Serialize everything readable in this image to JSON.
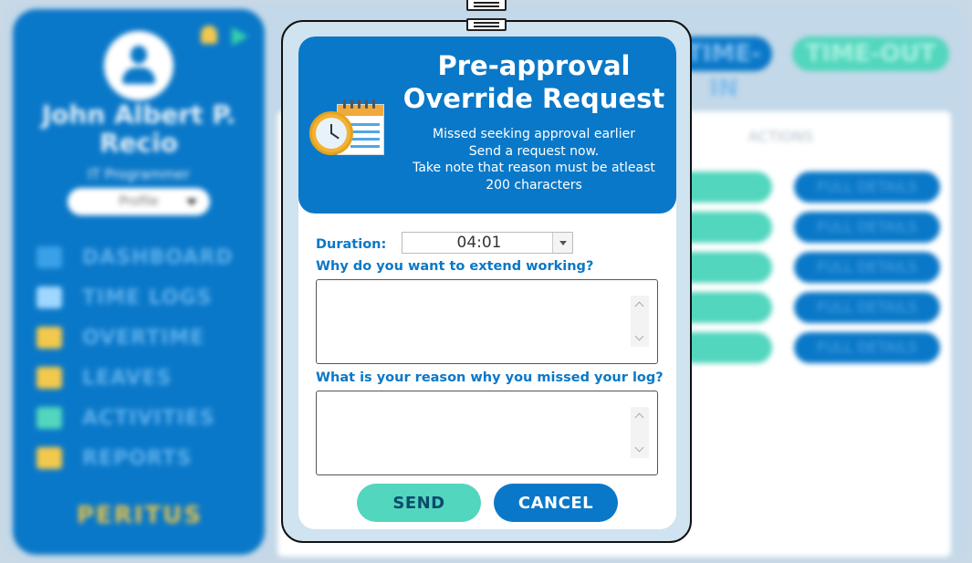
{
  "background": {
    "user": {
      "name": "John Albert P. Recio",
      "role": "IT Programmer",
      "profile_select": "Profile"
    },
    "nav": [
      {
        "label": "DASHBOARD",
        "icon": "chart-icon",
        "color": "#3aa0e8"
      },
      {
        "label": "TIME LOGS",
        "icon": "clock-icon",
        "color": "#9fd7ff"
      },
      {
        "label": "OVERTIME",
        "icon": "overtime-icon",
        "color": "#f2c94c"
      },
      {
        "label": "LEAVES",
        "icon": "leaves-icon",
        "color": "#f2c94c"
      },
      {
        "label": "ACTIVITIES",
        "icon": "activities-icon",
        "color": "#52d6bd"
      },
      {
        "label": "REPORTS",
        "icon": "reports-icon",
        "color": "#f2c94c"
      }
    ],
    "logo": "PERITUS",
    "time_in_label": "TIME-IN",
    "time_out_label": "TIME-OUT",
    "table": {
      "actions_header": "ACTIONS",
      "rows": [
        {
          "details_label": "FULL DETAILS"
        },
        {
          "details_label": "FULL DETAILS"
        },
        {
          "details_label": "FULL DETAILS"
        },
        {
          "details_label": "FULL DETAILS"
        },
        {
          "details_label": "FULL DETAILS"
        }
      ]
    }
  },
  "modal": {
    "title_line1": "Pre-approval",
    "title_line2": "Override Request",
    "desc_line1": "Missed seeking approval earlier",
    "desc_line2": "Send a request now.",
    "desc_line3": "Take note that reason must be atleast",
    "desc_line4": "200 characters",
    "duration_label": "Duration:",
    "duration_value": "04:01",
    "question1": "Why do you want to extend working?",
    "question2": "What is your reason why you missed your log?",
    "answer1": "",
    "answer2": "",
    "send_label": "SEND",
    "cancel_label": "CANCEL"
  },
  "colors": {
    "primary": "#0a78c8",
    "accent": "#52d6bd"
  }
}
